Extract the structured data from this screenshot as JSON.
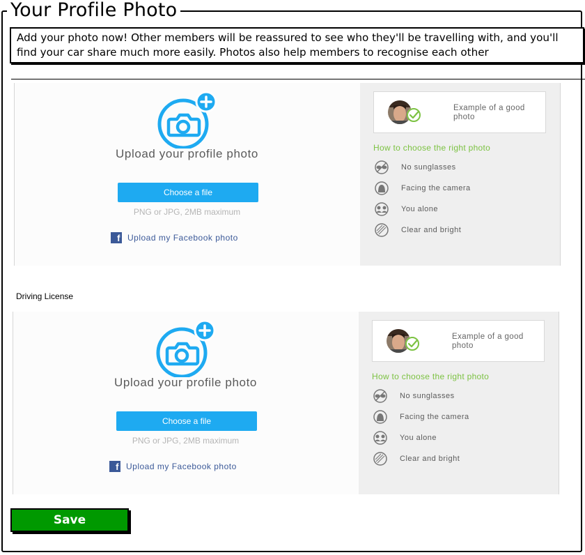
{
  "form": {
    "title": "Your Profile Photo",
    "intro": "Add your photo now! Other members will be reassured to see who they'll be travelling with, and you'll find your car share much more easily. Photos also help members to recognise each other",
    "second_section_label": "Driving License",
    "save_label": "Save"
  },
  "panels": [
    {
      "upload_title": "Upload your profile photo",
      "choose_file_label": "Choose a file",
      "file_hint": "PNG or JPG, 2MB maximum",
      "facebook_label": "Upload my Facebook photo",
      "example_label": "Example of a good photo",
      "tips_heading": "How to choose the right photo",
      "tips": [
        {
          "icon": "sunglasses-icon",
          "label": "No sunglasses"
        },
        {
          "icon": "face-icon",
          "label": "Facing the camera"
        },
        {
          "icon": "group-icon",
          "label": "You alone"
        },
        {
          "icon": "brightness-icon",
          "label": "Clear and bright"
        }
      ]
    },
    {
      "upload_title": "Upload your profile photo",
      "choose_file_label": "Choose a file",
      "file_hint": "PNG or JPG, 2MB maximum",
      "facebook_label": "Upload my Facebook photo",
      "example_label": "Example of a good photo",
      "tips_heading": "How to choose the right photo",
      "tips": [
        {
          "icon": "sunglasses-icon",
          "label": "No sunglasses"
        },
        {
          "icon": "face-icon",
          "label": "Facing the camera"
        },
        {
          "icon": "group-icon",
          "label": "You alone"
        },
        {
          "icon": "brightness-icon",
          "label": "Clear and bright"
        }
      ]
    }
  ],
  "colors": {
    "primary_button": "#1eaaf1",
    "tips_heading": "#7cc242",
    "facebook": "#3b5998",
    "save_button": "#009900"
  }
}
